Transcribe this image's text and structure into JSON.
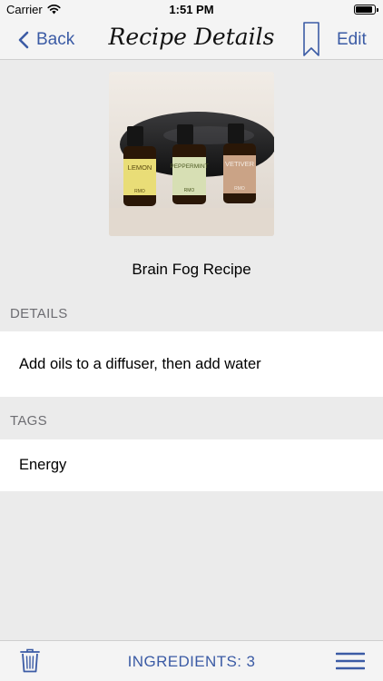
{
  "status_bar": {
    "carrier": "Carrier",
    "time": "1:51 PM"
  },
  "nav": {
    "back_label": "Back",
    "title": "Recipe Details",
    "edit_label": "Edit"
  },
  "recipe": {
    "name": "Brain Fog Recipe",
    "image_bottle_labels": [
      "LEMON",
      "PEPPERMINT",
      "VETIVER"
    ],
    "image_brand": "RMO"
  },
  "sections": {
    "details_header": "DETAILS",
    "details_text": "Add oils to a diffuser, then add water",
    "tags_header": "TAGS",
    "tags_text": "Energy"
  },
  "toolbar": {
    "ingredients_label": "INGREDIENTS: 3"
  },
  "colors": {
    "accent": "#3b5ba5",
    "background": "#ebebeb",
    "bars": "#f4f4f4"
  }
}
